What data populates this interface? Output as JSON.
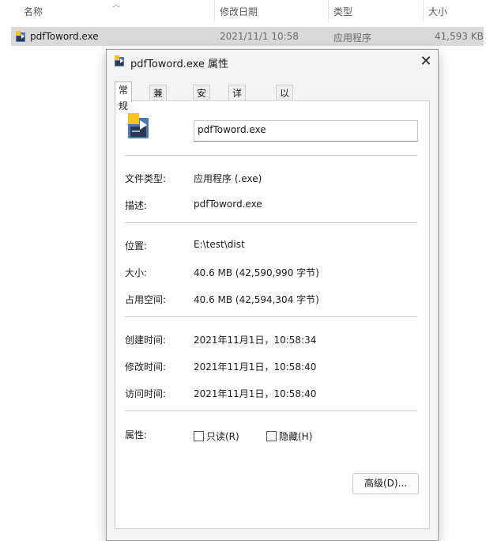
{
  "explorer": {
    "columns": [
      "名称",
      "修改日期",
      "类型",
      "大小"
    ],
    "file": {
      "name": "pdfToword.exe",
      "modified": "2021/11/1 10:58",
      "type": "应用程序",
      "size": "41,593 KB"
    }
  },
  "dialog": {
    "title": "pdfToword.exe 属性",
    "close_icon": "close-icon",
    "tabs": [
      "常规",
      "兼容性",
      "安全",
      "详细信息",
      "以前的版本"
    ],
    "active_tab": "常规",
    "file_name": "pdfToword.exe",
    "props": {
      "file_type_label": "文件类型:",
      "file_type_value": "应用程序 (.exe)",
      "description_label": "描述:",
      "description_value": "pdfToword.exe",
      "location_label": "位置:",
      "location_value": "E:\\test\\dist",
      "size_label": "大小:",
      "size_value": "40.6 MB (42,590,990 字节)",
      "size_on_disk_label": "占用空间:",
      "size_on_disk_value": "40.6 MB (42,594,304 字节)",
      "created_label": "创建时间:",
      "created_value": "2021年11月1日，10:58:34",
      "modified_label": "修改时间:",
      "modified_value": "2021年11月1日，10:58:40",
      "accessed_label": "访问时间:",
      "accessed_value": "2021年11月1日，10:58:40",
      "attributes_label": "属性:"
    },
    "attributes": {
      "readonly_label": "只读(R)",
      "readonly_checked": false,
      "hidden_label": "隐藏(H)",
      "hidden_checked": false,
      "advanced_button": "高级(D)..."
    }
  }
}
